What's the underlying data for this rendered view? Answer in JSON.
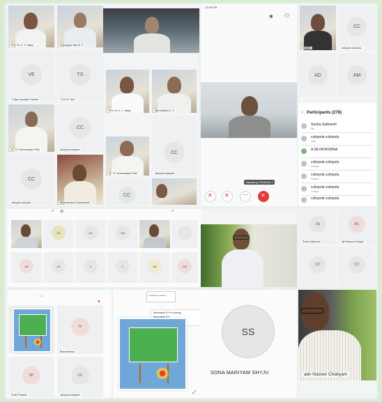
{
  "colors": {
    "background": "#d8ecd1",
    "avatar_gray": "#e4e6e8",
    "end_call_red": "#e53935",
    "accent_blue": "#3a7bd5"
  },
  "top_left_panel": {
    "tiles": [
      {
        "name": "Prof. Dr. K. V. Jaisey"
      },
      {
        "name": "Kannappan Nair M. P"
      },
      {
        "initials": "VE",
        "name": "V.Vijay Goswami Ganesh"
      },
      {
        "initials": "TS",
        "name": "T.S.K.M. Vinit"
      },
      {
        "name": "Dr. T.P. Mohandasan Pillai"
      },
      {
        "initials": "CC",
        "name": "csilopola csilopola"
      },
      {
        "initials": "CC",
        "name": "csilopola csilopola"
      },
      {
        "name": "Balachandran Chandranath"
      }
    ]
  },
  "top_middle_panel": {
    "tiles": [
      {
        "name": "Prof. Dr. K. V. Jaisey"
      },
      {
        "name": "Ajith Mathew R. S."
      },
      {
        "name": "Dr. T.P. Mohandasan Pillai"
      },
      {
        "initials": "CC",
        "name": "csilopola csilopola"
      },
      {
        "name": "Dr. T.P. Mohandasan Pillai"
      },
      {
        "initials": "CC",
        "name": "csilopola csilopola"
      },
      {
        "initials": "CC",
        "name": ""
      }
    ]
  },
  "phone_call": {
    "status_time": "12:00 PM",
    "speaking_label": "Speaking: PRASAD J",
    "buttons": [
      "mic-off",
      "video-off",
      "more",
      "end-call"
    ]
  },
  "right_panel": {
    "tiles": [
      {
        "initials": "",
        "name": "Minister"
      },
      {
        "initials": "CC",
        "name": "csilopola csilopola"
      },
      {
        "initials": "AD",
        "name": ""
      },
      {
        "initials": "AM",
        "name": ""
      }
    ],
    "participants_header": "Participants (278)",
    "participants": [
      {
        "name": "Sneha Satheesh",
        "sub": "Me"
      },
      {
        "name": "csilopola csilopola",
        "sub": "Host"
      },
      {
        "name": "A DEVIKRISHNA",
        "sub": ""
      },
      {
        "name": "csilopola csilopola",
        "sub": "Cohost"
      },
      {
        "name": "csilopola csilopola",
        "sub": "Cohost"
      },
      {
        "name": "csilopola csilopola",
        "sub": "Cohost"
      },
      {
        "name": "csilopola csilopola",
        "sub": "Cohost"
      }
    ]
  },
  "mid_left_panel": {
    "tiles": [
      "",
      "AS",
      "AD",
      "SM",
      "",
      "",
      "AB",
      "AS",
      "K",
      "C",
      "AB",
      "AM"
    ]
  },
  "mid_center_panel": {},
  "mid_right_panel": {
    "tiles": [
      {
        "initials": "SS",
        "name": "Sneha Satheesh"
      },
      {
        "initials": "AC",
        "name": "Ajit Hassan Chakyar"
      },
      {
        "initials": "CC",
        "name": ""
      },
      {
        "initials": "CC",
        "name": ""
      }
    ]
  },
  "bottom_left_panel": {
    "tiles": [
      {
        "initials": "",
        "name": ""
      },
      {
        "initials": "N",
        "name": "Bhavanthana"
      },
      {
        "initials": "SP",
        "name": "Sruthi Prakash"
      },
      {
        "initials": "CC",
        "name": "csilopola csilopola"
      }
    ]
  },
  "bottom_center_panel": {
    "popup_title": "Meenakshi R.P is sharing",
    "popup_line2": "Meenakshi R.P",
    "popup_line3": "certificate invitation"
  },
  "bottom_right_panel": {
    "avatar_initials": "SS",
    "avatar_name": "SONA MARIYAM SHYJU",
    "video_name": "adv Nazeer Chaliyam"
  }
}
